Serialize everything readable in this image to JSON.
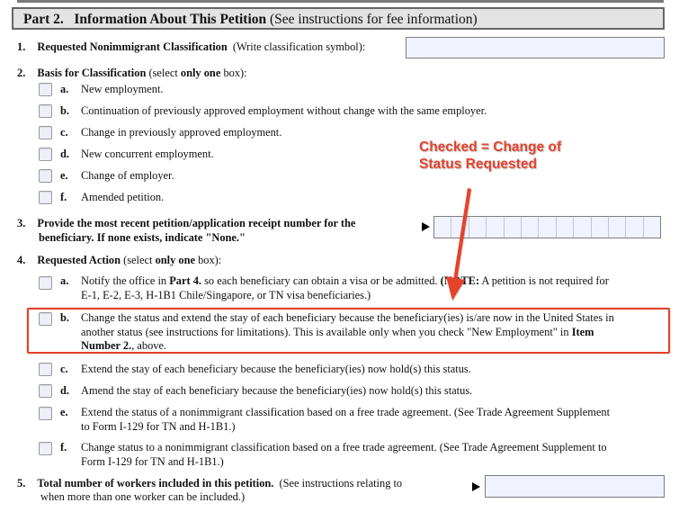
{
  "part": {
    "label": "Part 2.",
    "title": "Information About This Petition",
    "note": "(See instructions for fee information)"
  },
  "item1": {
    "number": "1.",
    "label": "Requested Nonimmigrant Classification",
    "hint": "(Write classification symbol):",
    "value": ""
  },
  "item2": {
    "number": "2.",
    "label": "Basis for Classification",
    "hint_pre": "(select",
    "hint_bold": "only one",
    "hint_post": "box):",
    "options": [
      {
        "letter": "a.",
        "text": "New employment.",
        "checked": false
      },
      {
        "letter": "b.",
        "text": "Continuation of previously approved employment without change with the same employer.",
        "checked": false
      },
      {
        "letter": "c.",
        "text": "Change in previously approved employment.",
        "checked": false
      },
      {
        "letter": "d.",
        "text": "New concurrent employment.",
        "checked": false
      },
      {
        "letter": "e.",
        "text": "Change of employer.",
        "checked": false
      },
      {
        "letter": "f.",
        "text": "Amended petition.",
        "checked": false
      }
    ]
  },
  "item3": {
    "number": "3.",
    "line1": "Provide the most recent petition/application receipt number for the",
    "line2": "beneficiary.  If none exists, indicate \"None.\"",
    "cells": 13,
    "value": ""
  },
  "item4": {
    "number": "4.",
    "label": "Requested Action",
    "hint_pre": "(select",
    "hint_bold": "only one",
    "hint_post": "box):",
    "options": [
      {
        "letter": "a.",
        "line1_pre": "Notify the office in",
        "line1_bold": "Part 4.",
        "line1_post": "so each beneficiary can obtain a visa or be admitted.",
        "note_bold": "(NOTE:",
        "note_rest": "A petition is not required for",
        "line2": "E-1, E-2, E-3, H-1B1 Chile/Singapore, or TN visa beneficiaries.)",
        "checked": false
      },
      {
        "letter": "b.",
        "line1": "Change the status and extend the stay of each beneficiary because the beneficiary(ies) is/are now in the United States in",
        "line2_pre": "another status (see instructions for limitations).  This is available only when you check \"New Employment\" in",
        "line2_bold": "Item",
        "line3_bold": "Number 2.",
        "line3_post": ", above.",
        "checked": false
      },
      {
        "letter": "c.",
        "line1": "Extend the stay of each beneficiary because the beneficiary(ies) now hold(s) this status.",
        "checked": false
      },
      {
        "letter": "d.",
        "line1": "Amend the stay of each beneficiary because the beneficiary(ies) now hold(s) this status.",
        "checked": false
      },
      {
        "letter": "e.",
        "line1": "Extend the status of a nonimmigrant classification based on a free trade agreement.  (See Trade Agreement Supplement",
        "line2": "to Form I-129 for TN and H-1B1.)",
        "checked": false
      },
      {
        "letter": "f.",
        "line1": "Change status to a nonimmigrant classification based on a free trade agreement.  (See Trade Agreement Supplement to",
        "line2": "Form I-129 for TN and H-1B1.)",
        "checked": false
      }
    ]
  },
  "item5": {
    "number": "5.",
    "label": "Total number of workers included in this petition.",
    "hint": "(See instructions relating to",
    "line2": "when more than one worker can be included.)",
    "value": ""
  },
  "annotation": {
    "line1": "Checked = Change of",
    "line2": "Status Requested",
    "color": "#e5422b",
    "icon": "arrow-icon"
  }
}
